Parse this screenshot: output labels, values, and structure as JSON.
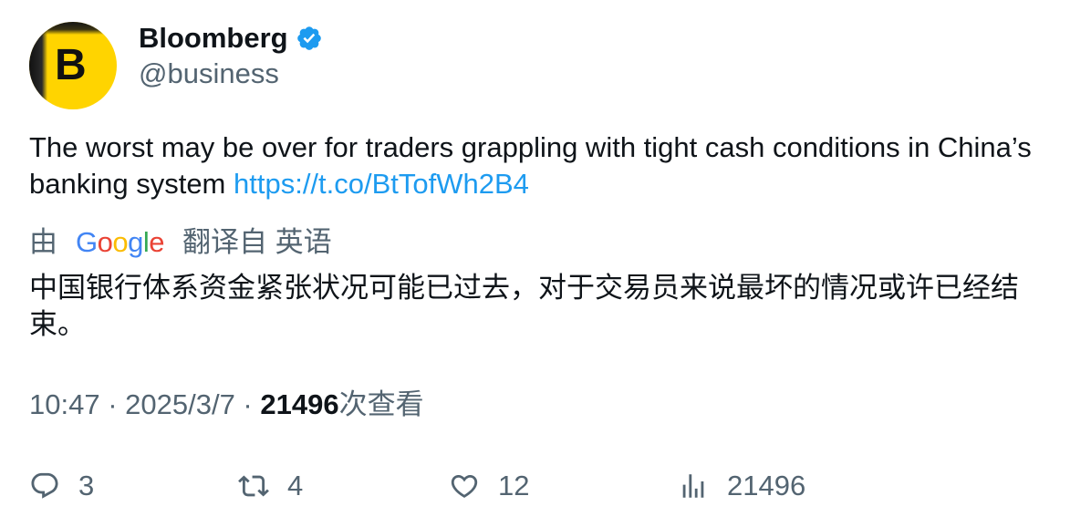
{
  "author": {
    "name": "Bloomberg",
    "handle": "@business",
    "avatar_letter": "B",
    "verified": true
  },
  "tweet": {
    "text": "The worst may be over for traders grappling with tight cash conditions in China’s banking system ",
    "link": "https://t.co/BtTofWh2B4"
  },
  "translation": {
    "prefix": "由",
    "provider_letters": [
      "G",
      "o",
      "o",
      "g",
      "l",
      "e"
    ],
    "suffix": "翻译自 英语",
    "text": "中国银行体系资金紧张状况可能已过去，对于交易员来说最坏的情况或许已经结束。"
  },
  "meta": {
    "time": "10:47",
    "separator": " · ",
    "date": "2025/3/7",
    "views_count": "21496",
    "views_label": "次查看"
  },
  "actions": {
    "replies": "3",
    "retweets": "4",
    "likes": "12",
    "views": "21496"
  },
  "colors": {
    "link": "#1d9bf0",
    "secondary_text": "#536471",
    "primary_text": "#0f1419",
    "avatar_bg": "#ffd400",
    "verified_badge": "#1d9bf0"
  }
}
